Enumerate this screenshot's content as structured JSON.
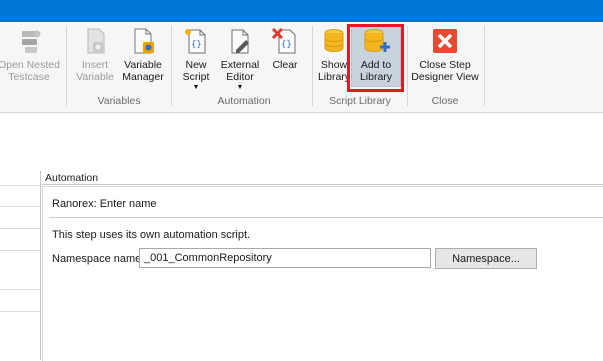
{
  "ribbon": {
    "open_nested": "Open Nested Testcase",
    "insert_variable": [
      "Insert",
      "Variable"
    ],
    "variable_manager": [
      "Variable",
      "Manager"
    ],
    "new_script": [
      "New",
      "Script"
    ],
    "external_editor": [
      "External",
      "Editor"
    ],
    "clear": "Clear",
    "show_library": [
      "Show",
      "Library"
    ],
    "add_to_library": [
      "Add to",
      "Library"
    ],
    "close_step_designer": [
      "Close Step",
      "Designer View"
    ],
    "groups": {
      "variables": "Variables",
      "automation": "Automation",
      "script_library": "Script Library",
      "close": "Close"
    }
  },
  "main": {
    "column_header": "Automation",
    "panel_title": "Ranorex: Enter name",
    "description": "This step uses its own automation script.",
    "namespace_label": "Namespace name",
    "namespace_value": "_001_CommonRepository",
    "namespace_button": "Namespace..."
  },
  "colors": {
    "titlebar": "#0078d7",
    "highlight": "#e01b24",
    "selected_button": "#c9d3dd"
  }
}
